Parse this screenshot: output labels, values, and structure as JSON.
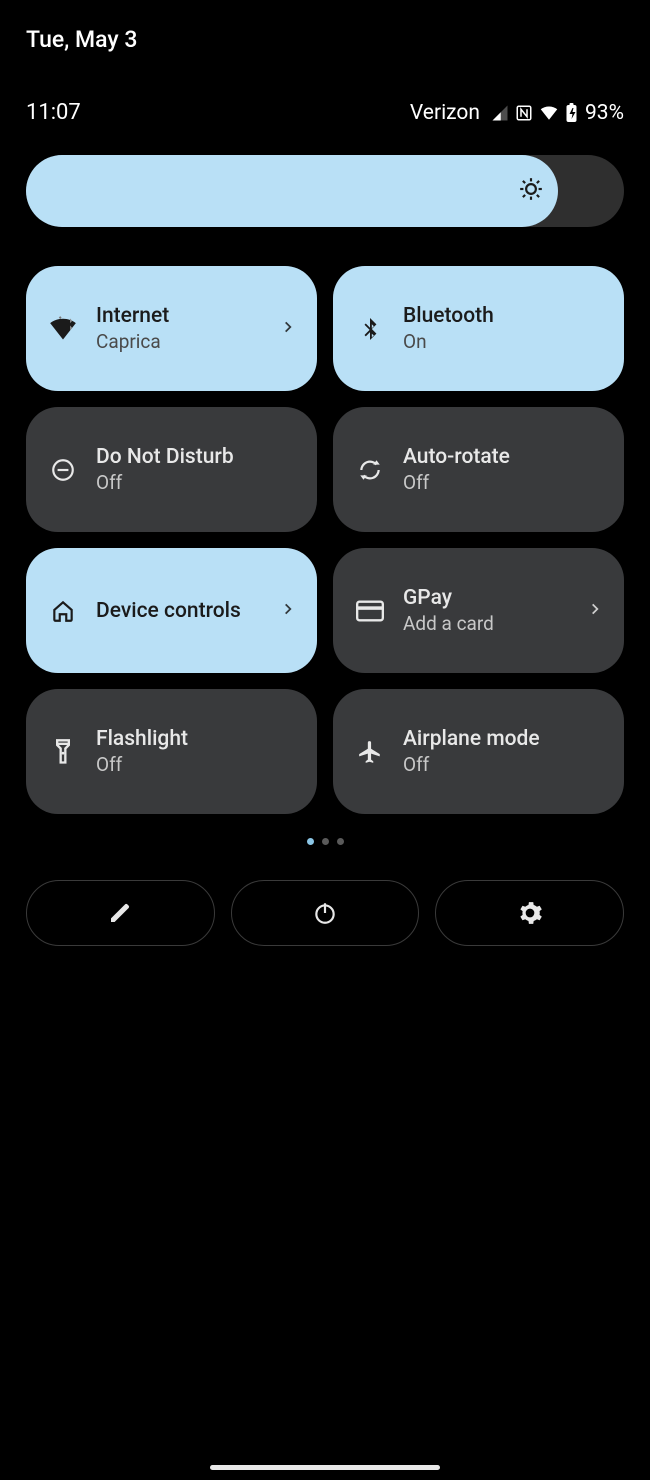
{
  "date": "Tue, May 3",
  "time": "11:07",
  "carrier": "Verizon",
  "battery": "93%",
  "brightness": {
    "percent": 89
  },
  "tiles": [
    {
      "icon": "wifi-icon",
      "title": "Internet",
      "sub": "Caprica",
      "on": true,
      "chev": true
    },
    {
      "icon": "bluetooth-icon",
      "title": "Bluetooth",
      "sub": "On",
      "on": true,
      "chev": false
    },
    {
      "icon": "dnd-icon",
      "title": "Do Not Disturb",
      "sub": "Off",
      "on": false,
      "chev": false
    },
    {
      "icon": "autorotate-icon",
      "title": "Auto-rotate",
      "sub": "Off",
      "on": false,
      "chev": false
    },
    {
      "icon": "home-icon",
      "title": "Device controls",
      "sub": "",
      "on": true,
      "chev": true
    },
    {
      "icon": "card-icon",
      "title": "GPay",
      "sub": "Add a card",
      "on": false,
      "chev": true
    },
    {
      "icon": "flashlight-icon",
      "title": "Flashlight",
      "sub": "Off",
      "on": false,
      "chev": false
    },
    {
      "icon": "airplane-icon",
      "title": "Airplane mode",
      "sub": "Off",
      "on": false,
      "chev": false
    }
  ],
  "pager": {
    "count": 3,
    "active": 0
  },
  "bottom": {
    "edit": "edit",
    "power": "power",
    "settings": "settings"
  }
}
